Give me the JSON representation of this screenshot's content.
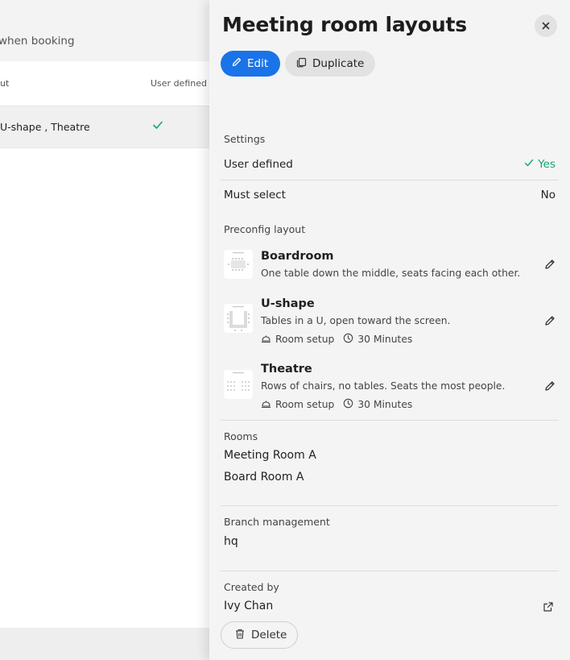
{
  "background": {
    "hint_text": "when booking",
    "table": {
      "col_layout": "ut",
      "col_user_defined": "User defined",
      "row_layouts": "U-shape , Theatre"
    }
  },
  "panel": {
    "title": "Meeting room layouts",
    "edit_label": "Edit",
    "duplicate_label": "Duplicate",
    "settings": {
      "heading": "Settings",
      "user_defined_label": "User defined",
      "user_defined_value": "Yes",
      "must_select_label": "Must select",
      "must_select_value": "No"
    },
    "preconfig": {
      "heading": "Preconfig layout",
      "items": [
        {
          "name": "Boardroom",
          "description": "One table down the middle, seats facing each other.",
          "icon": "boardroom-layout-icon"
        },
        {
          "name": "U-shape",
          "description": "Tables in a U, open toward the screen.",
          "setup_label": "Room setup",
          "duration": "30 Minutes",
          "icon": "u-shape-layout-icon"
        },
        {
          "name": "Theatre",
          "description": "Rows of chairs, no tables. Seats the most people.",
          "setup_label": "Room setup",
          "duration": "30 Minutes",
          "icon": "theatre-layout-icon"
        }
      ]
    },
    "rooms": {
      "heading": "Rooms",
      "items": [
        "Meeting Room A",
        "Board Room A"
      ]
    },
    "branch": {
      "heading": "Branch management",
      "value": "hq"
    },
    "created_by": {
      "heading": "Created by",
      "value": "Ivy Chan"
    },
    "delete_label": "Delete"
  },
  "colors": {
    "accent": "#1a73e8",
    "success": "#12a37a"
  }
}
